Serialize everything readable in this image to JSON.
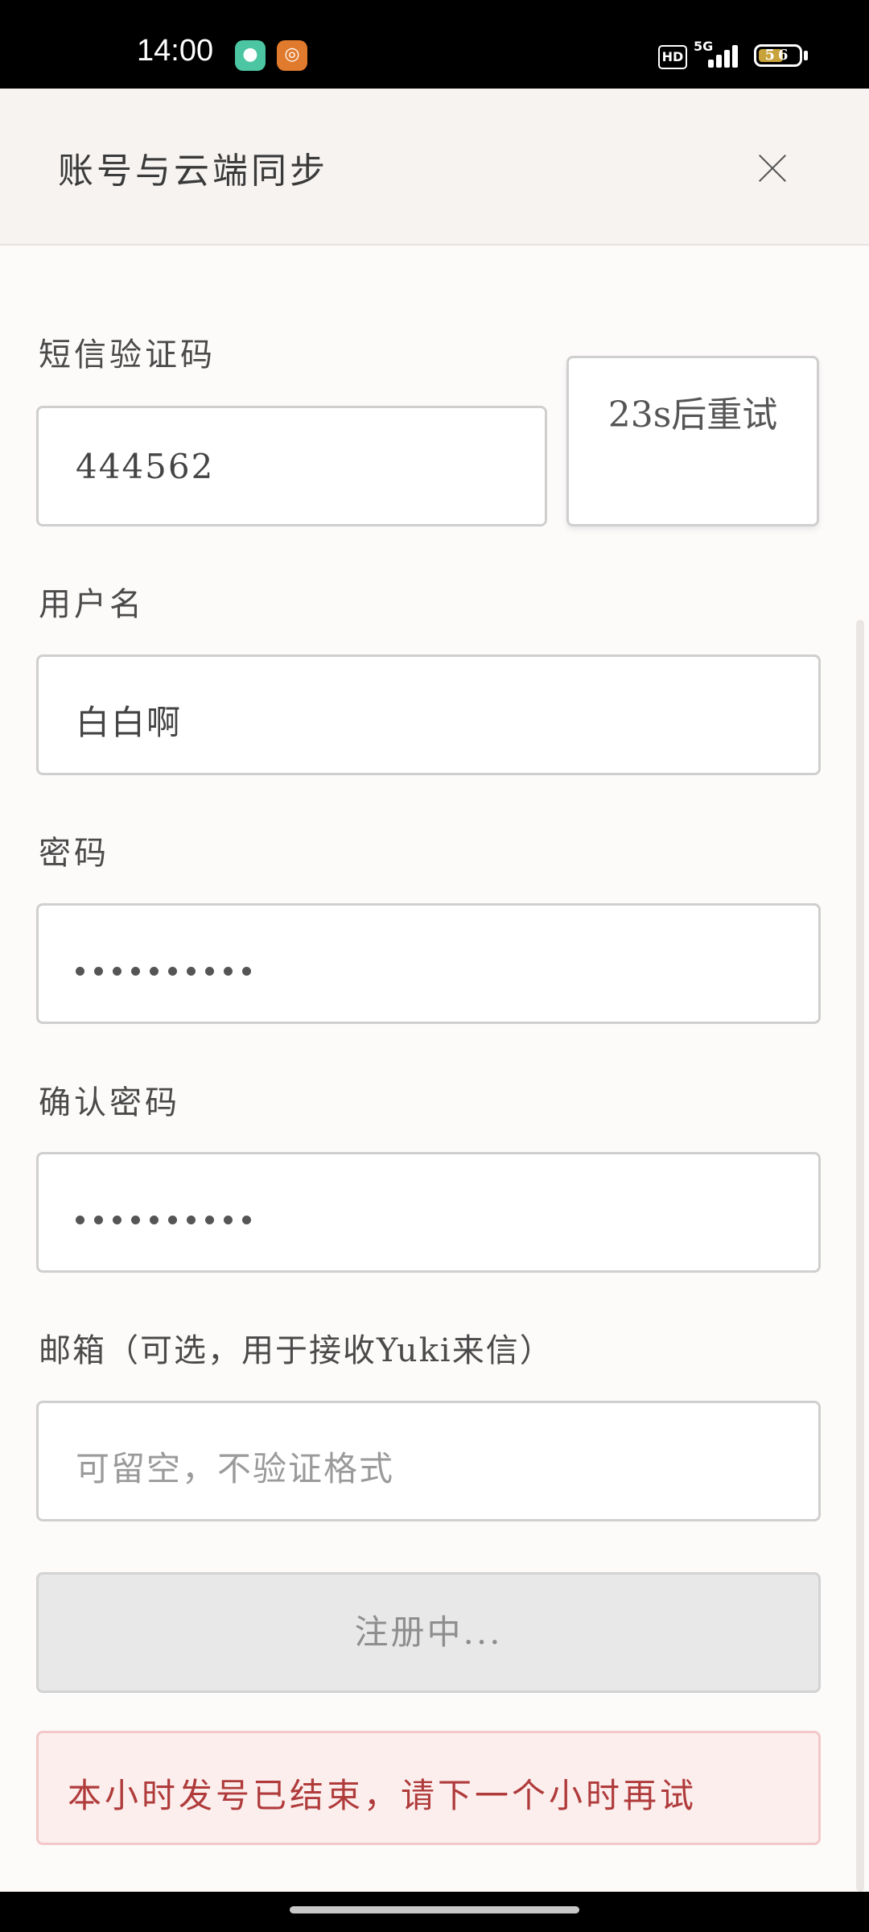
{
  "status_bar": {
    "time": "14:00",
    "network": "5G",
    "hd_label": "HD",
    "battery_level": "56",
    "icons": [
      "shield-app-icon",
      "target-app-icon",
      "signal-icon",
      "battery-icon"
    ]
  },
  "header": {
    "title": "账号与云端同步",
    "close_icon": "close-icon"
  },
  "form": {
    "sms_code": {
      "label": "短信验证码",
      "value": "444562"
    },
    "retry_button": {
      "label": "23s后重试"
    },
    "username": {
      "label": "用户名",
      "value": "白白啊"
    },
    "password": {
      "label": "密码",
      "masked_length": 10
    },
    "confirm_password": {
      "label": "确认密码",
      "masked_length": 10
    },
    "email": {
      "label": "邮箱（可选，用于接收Yuki来信）",
      "placeholder": "可留空，不验证格式",
      "value": ""
    },
    "submit_button": {
      "label": "注册中..."
    },
    "error_message": "本小时发号已结束，请下一个小时再试"
  },
  "colors": {
    "background": "#fdfbfa",
    "header_bg": "#f6f3f1",
    "error_text": "#b03b3b",
    "error_bg": "#fdeeee",
    "disabled_button_bg": "#e8e8e8"
  }
}
